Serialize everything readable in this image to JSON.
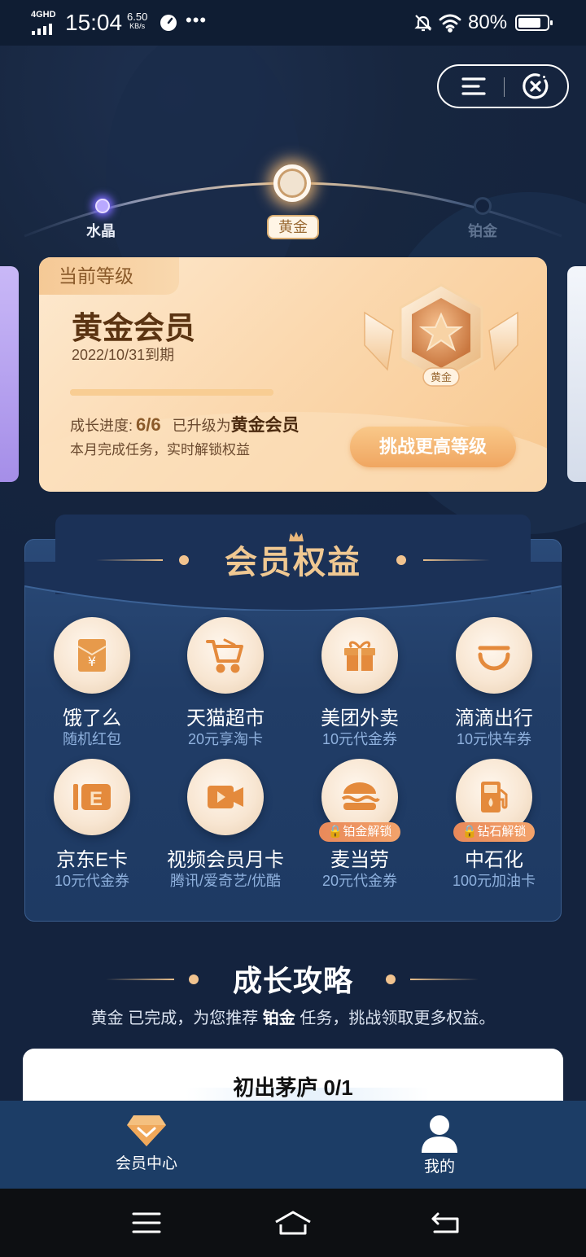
{
  "status_bar": {
    "network": "4GHD",
    "time": "15:04",
    "speed_value": "6.50",
    "speed_unit": "KB/s",
    "more": "•••",
    "battery": "80%",
    "battery_level": 0.8
  },
  "header": {
    "menu_icon": "menu-icon",
    "close_icon": "close-icon"
  },
  "levels": [
    {
      "label": "水晶",
      "state": "passed"
    },
    {
      "label": "黄金",
      "state": "current"
    },
    {
      "label": "铂金",
      "state": "locked"
    }
  ],
  "current_card": {
    "tab": "当前等级",
    "title": "黄金会员",
    "expire": "2022/10/31到期",
    "progress_label": "成长进度:",
    "progress_value": "6/6",
    "progress_fraction": 1.0,
    "upgraded_prefix": "已升级为",
    "upgraded_level": "黄金会员",
    "subtitle": "本月完成任务，实时解锁权益",
    "badge_label": "黄金",
    "challenge_button": "挑战更高等级"
  },
  "benefits": {
    "title": "会员权益",
    "items": [
      {
        "name": "饿了么",
        "desc": "随机红包",
        "icon": "red-envelope-icon",
        "lock": ""
      },
      {
        "name": "天猫超市",
        "desc": "20元享淘卡",
        "icon": "shopping-cart-icon",
        "lock": ""
      },
      {
        "name": "美团外卖",
        "desc": "10元代金券",
        "icon": "gift-box-icon",
        "lock": ""
      },
      {
        "name": "滴滴出行",
        "desc": "10元快车券",
        "icon": "didi-icon",
        "lock": ""
      },
      {
        "name": "京东E卡",
        "desc": "10元代金券",
        "icon": "e-card-icon",
        "lock": ""
      },
      {
        "name": "视频会员月卡",
        "desc": "腾讯/爱奇艺/优酷",
        "icon": "video-camera-icon",
        "lock": ""
      },
      {
        "name": "麦当劳",
        "desc": "20元代金券",
        "icon": "burger-icon",
        "lock": "铂金解锁"
      },
      {
        "name": "中石化",
        "desc": "100元加油卡",
        "icon": "fuel-pump-icon",
        "lock": "钻石解锁"
      }
    ]
  },
  "growth": {
    "title": "成长攻略",
    "sub_level": "黄金",
    "sub_mid": "已完成，为您推荐",
    "sub_target": "铂金",
    "sub_end": "任务，挑战领取更多权益。",
    "task_title": "初出茅庐 0/1"
  },
  "tabs": [
    {
      "label": "会员中心",
      "icon": "diamond-icon"
    },
    {
      "label": "我的",
      "icon": "user-icon"
    }
  ],
  "colors": {
    "background": "#14233e",
    "gold_accent": "#f0c892",
    "tab_bar": "#1c3d66"
  }
}
